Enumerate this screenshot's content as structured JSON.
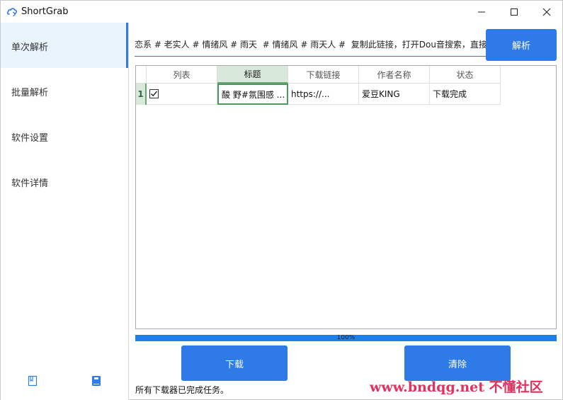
{
  "window": {
    "title": "ShortGrab",
    "controls": [
      "minimize",
      "maximize",
      "close"
    ]
  },
  "sidebar": {
    "items": [
      {
        "label": "单次解析",
        "active": true
      },
      {
        "label": "批量解析",
        "active": false
      },
      {
        "label": "软件设置",
        "active": false
      },
      {
        "label": "软件详情",
        "active": false
      }
    ],
    "bottom_icons": [
      "bookmark-outline-icon",
      "book-icon"
    ]
  },
  "url_bar": {
    "value": "恋系 # 老实人 # 情绪风 # 雨天  # 情绪风 # 雨天人 #  复制此链接，打开Dou音搜索，直接观看视频！",
    "parse_label": "解析"
  },
  "table": {
    "headers": [
      "列表",
      "标题",
      "下载链接",
      "作者名称",
      "状态"
    ],
    "rows": [
      {
        "index": "1",
        "checked": true,
        "title": "酸 野#氛围感 ...",
        "link": "https://...",
        "author": "爱豆KING",
        "status": "下载完成"
      }
    ]
  },
  "progress": {
    "value": 100,
    "label": "100%"
  },
  "buttons": {
    "download": "下载",
    "clear": "清除"
  },
  "status_text": "所有下载器已完成任务。",
  "watermark": "www.bndqg.net 不懂社区",
  "colors": {
    "accent": "#2e7ae7",
    "selection": "#d8e8da",
    "selection_border": "#4b9a5d",
    "watermark": "#e2315e"
  }
}
